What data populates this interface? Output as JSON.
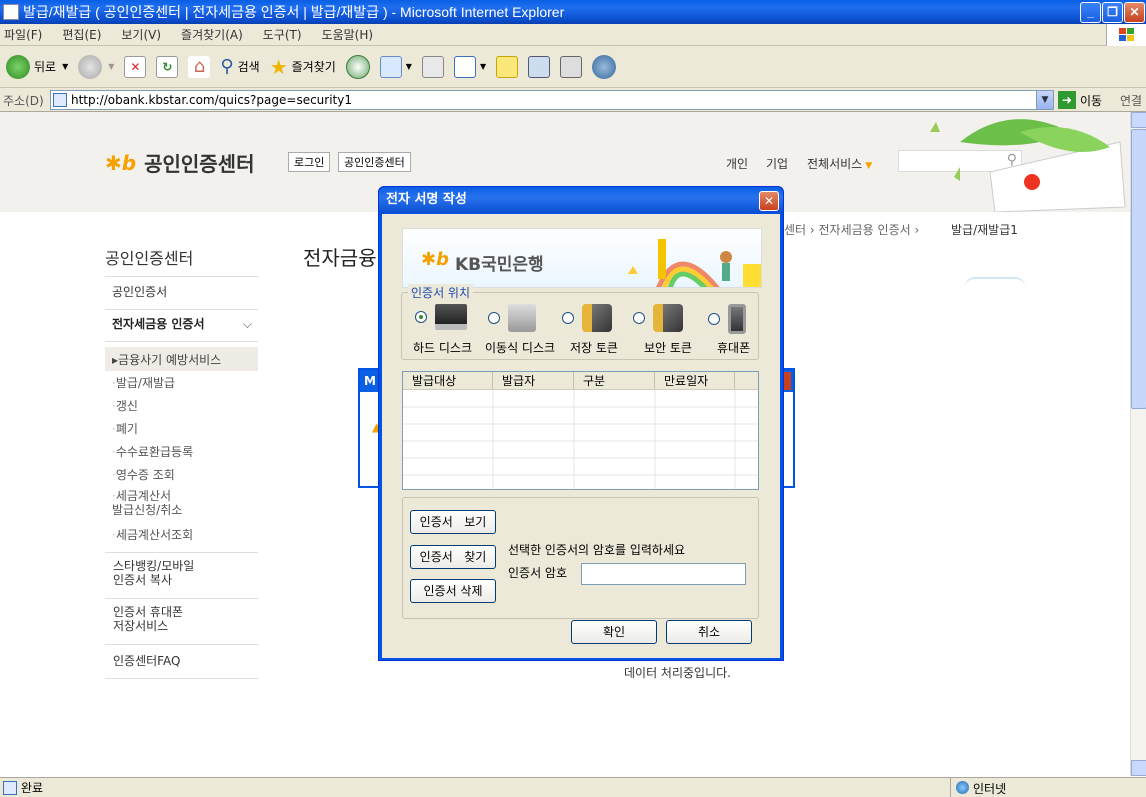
{
  "window": {
    "title": "발급/재발급 ( 공인인증센터 | 전자세금용 인증서 | 발급/재발급 ) - Microsoft Internet Explorer"
  },
  "menu": [
    "파일(F)",
    "편집(E)",
    "보기(V)",
    "즐겨찾기(A)",
    "도구(T)",
    "도움말(H)"
  ],
  "toolbar": {
    "back": "뒤로",
    "search": "검색",
    "favorites": "즐겨찾기"
  },
  "address": {
    "label": "주소(D)",
    "url": "http://obank.kbstar.com/quics?page=security1",
    "go": "이동",
    "links": "연결"
  },
  "site": {
    "brand": "공인인증센터",
    "login": "로그인",
    "center": "공인인증센터",
    "nav": [
      "개인",
      "기업",
      "전체서비스"
    ],
    "breadcrumb": "센터 › 전자세금용 인증서 › ",
    "breadcrumb_current": "발급/재발급1",
    "page_title": "전자금융",
    "side_title": "공인인증센터",
    "side_menu": {
      "item1": "공인인증서",
      "item2": "전자세금용 인증서",
      "sub": [
        "금융사기 예방서비스",
        "발급/재발급",
        "갱신",
        "폐기",
        "수수료환급등록",
        "영수증 조회",
        "세금계산서\n발급신청/취소",
        "세금계산서조회"
      ],
      "item3": "스타뱅킹/모바일\n인증서 복사",
      "item4": "인증서 휴대폰\n저장서비스",
      "item5": "인증센터FAQ"
    },
    "processing": "데이터 처리중입니다."
  },
  "dialog": {
    "title": "전자 서명 작성",
    "bank": "KB국민은행",
    "location_label": "인증서 위치",
    "locations": [
      "하드 디스크",
      "이동식 디스크",
      "저장 토큰",
      "보안 토큰",
      "휴대폰"
    ],
    "columns": [
      "발급대상",
      "발급자",
      "구분",
      "만료일자"
    ],
    "view_btn": "인증서   보기",
    "find_btn": "인증서   찾기",
    "delete_btn": "인증서 삭제",
    "prompt": "선택한 인증서의 암호를 입력하세요",
    "pw_label": "인증서 암호",
    "ok": "확인",
    "cancel": "취소"
  },
  "status": {
    "text": "완료",
    "zone": "인터넷"
  }
}
